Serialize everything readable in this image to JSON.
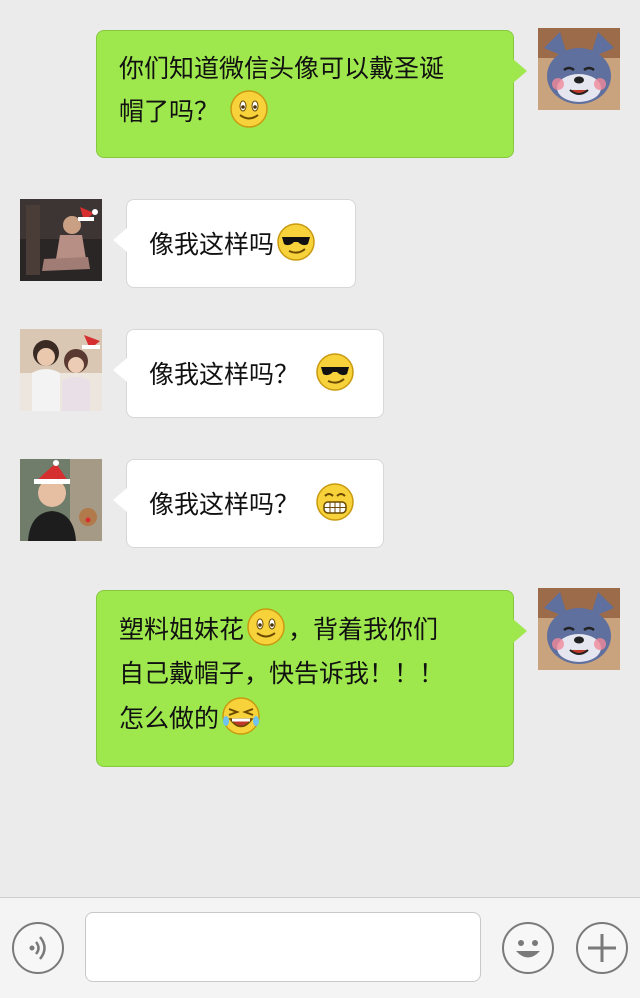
{
  "messages": [
    {
      "side": "out",
      "avatar": "tom-cat-avatar",
      "parts": [
        "你们知道微信头像可以戴圣诞",
        "帽了吗？"
      ],
      "emoji": [
        "smile-emoji"
      ]
    },
    {
      "side": "in",
      "avatar": "man-santa-hat-avatar",
      "parts": [
        "像我这样吗"
      ],
      "emoji": [
        "cool-sunglasses-emoji"
      ]
    },
    {
      "side": "in",
      "avatar": "couple-santa-hat-avatar",
      "parts": [
        "像我这样吗？"
      ],
      "emoji": [
        "cool-sunglasses-emoji"
      ]
    },
    {
      "side": "in",
      "avatar": "boy-santa-hat-avatar",
      "parts": [
        "像我这样吗？"
      ],
      "emoji": [
        "grin-emoji"
      ]
    },
    {
      "side": "out",
      "avatar": "tom-cat-avatar",
      "parts": [
        "塑料姐妹花",
        "，背着我你们",
        "自己戴帽子，快告诉我！！！",
        "怎么做的"
      ],
      "emoji": [
        "smile-emoji",
        "crying-laugh-emoji"
      ]
    }
  ],
  "colors": {
    "outgoing_bubble": "#9ee84e",
    "incoming_bubble": "#ffffff",
    "background": "#ebebeb"
  },
  "toolbar": {
    "voice_icon": "voice-icon",
    "emoji_icon": "emoji-face-icon",
    "plus_icon": "plus-icon",
    "input_value": ""
  }
}
